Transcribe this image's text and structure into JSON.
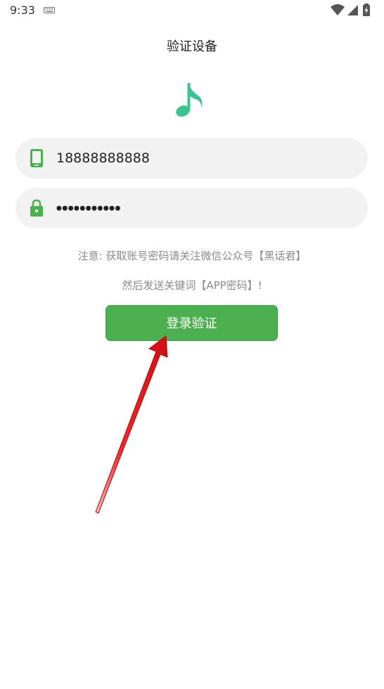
{
  "status_bar": {
    "time": "9:33",
    "icons": [
      "keyboard-icon",
      "wifi-icon",
      "cell-signal-icon",
      "battery-charging-icon"
    ]
  },
  "page": {
    "title": "验证设备",
    "logo_icon": "music-note-icon",
    "accent_color": "#3cc490"
  },
  "form": {
    "phone_icon": "phone-icon",
    "phone_value": "18888888888",
    "password_icon": "lock-icon",
    "password_value": "●●●●●●●●●●●"
  },
  "notice": {
    "line1": "注意: 获取账号密码请关注微信公众号【黑话君】",
    "line2": "然后发送关键词【APP密码】!"
  },
  "actions": {
    "login_label": "登录验证",
    "button_color": "#4caf50"
  },
  "annotation": {
    "arrow_icon": "red-arrow-icon",
    "arrow_color": "#e8161a"
  }
}
